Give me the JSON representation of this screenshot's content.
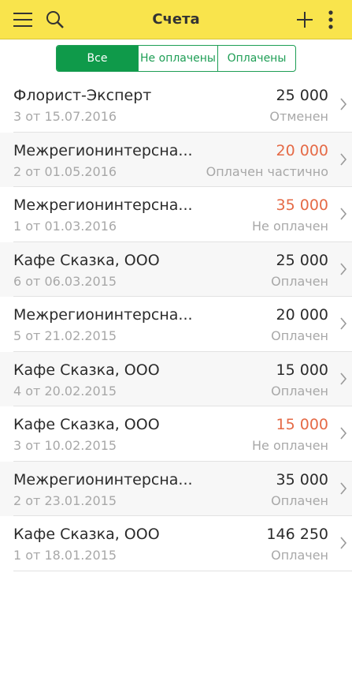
{
  "header": {
    "title": "Счета",
    "icons": {
      "menu": "menu-icon",
      "search": "search-icon",
      "add": "plus-icon",
      "more": "more-vertical-icon"
    },
    "color": "#f9e44c"
  },
  "filter": {
    "tabs": [
      {
        "label": "Все",
        "active": true
      },
      {
        "label": "Не оплачены",
        "active": false
      },
      {
        "label": "Оплачены",
        "active": false
      }
    ],
    "accent": "#1e9e55"
  },
  "invoices": [
    {
      "name": "Флорист-Эксперт",
      "number": "3 от 15.07.2016",
      "amount": "25 000",
      "status": "Отменен",
      "highlight": false
    },
    {
      "name": "Межрегионинтерсна...",
      "number": "2 от 01.05.2016",
      "amount": "20 000",
      "status": "Оплачен частично",
      "highlight": true
    },
    {
      "name": "Межрегионинтерсна...",
      "number": "1 от 01.03.2016",
      "amount": "35 000",
      "status": "Не оплачен",
      "highlight": true
    },
    {
      "name": "Кафе Сказка, ООО",
      "number": "6 от 06.03.2015",
      "amount": "25 000",
      "status": "Оплачен",
      "highlight": false
    },
    {
      "name": "Межрегионинтерсна...",
      "number": "5 от 21.02.2015",
      "amount": "20 000",
      "status": "Оплачен",
      "highlight": false
    },
    {
      "name": "Кафе Сказка, ООО",
      "number": "4 от 20.02.2015",
      "amount": "15 000",
      "status": "Оплачен",
      "highlight": false
    },
    {
      "name": "Кафе Сказка, ООО",
      "number": "3 от 10.02.2015",
      "amount": "15 000",
      "status": "Не оплачен",
      "highlight": true
    },
    {
      "name": "Межрегионинтерсна...",
      "number": "2 от 23.01.2015",
      "amount": "35 000",
      "status": "Оплачен",
      "highlight": false
    },
    {
      "name": "Кафе Сказка, ООО",
      "number": "1 от 18.01.2015",
      "amount": "146 250",
      "status": "Оплачен",
      "highlight": false
    }
  ],
  "colors": {
    "unpaid_amount": "#e56a46",
    "muted": "#a8a8a8"
  }
}
